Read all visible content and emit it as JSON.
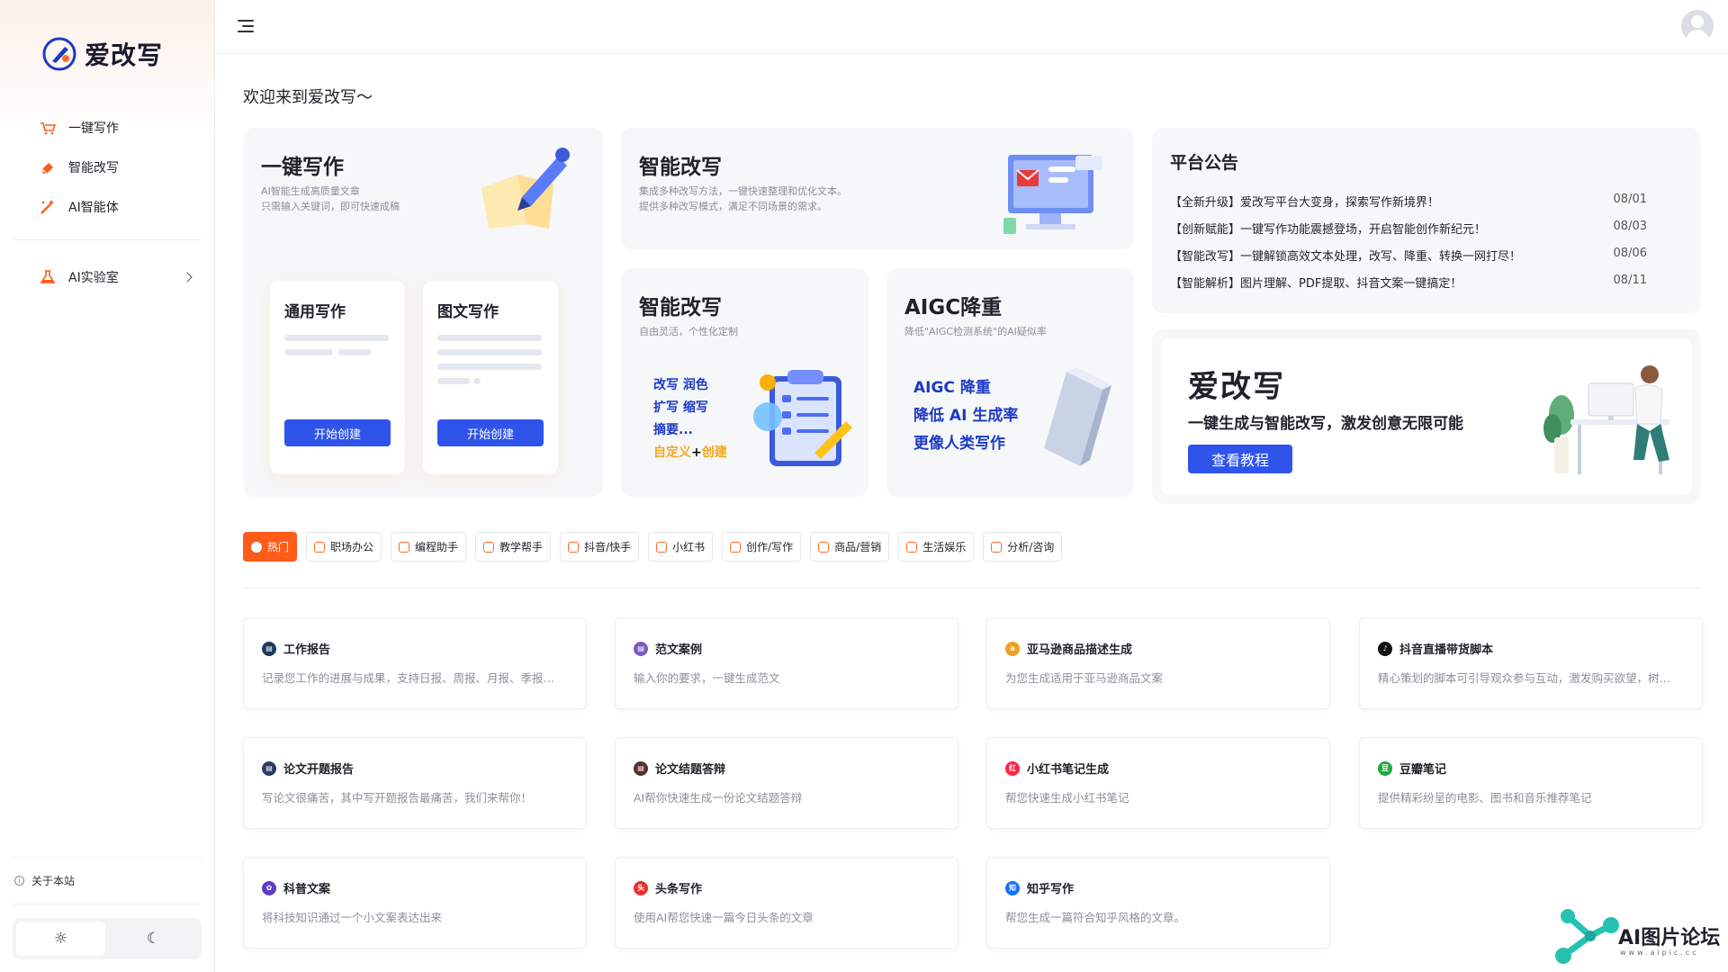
{
  "app": {
    "name": "爱改写"
  },
  "sidebar": {
    "items": [
      {
        "label": "一键写作",
        "icon": "cart-pen-icon"
      },
      {
        "label": "智能改写",
        "icon": "eraser-icon"
      },
      {
        "label": "AI智能体",
        "icon": "magic-wand-icon"
      }
    ],
    "lab": {
      "label": "AI实验室",
      "icon": "flask-icon"
    },
    "about": "关于本站",
    "theme": {
      "light": "☼",
      "dark": "☾"
    }
  },
  "main": {
    "welcome": "欢迎来到爱改写～",
    "write_card": {
      "title": "一键写作",
      "desc1": "AI智能生成高质量文章",
      "desc2": "只需输入关键词，即可快速成稿",
      "general": {
        "title": "通用写作",
        "button": "开始创建"
      },
      "graphic": {
        "title": "图文写作",
        "button": "开始创建"
      }
    },
    "rewrite_card_top": {
      "title": "智能改写",
      "desc1": "集成多种改写方法，一键快速整理和优化文本。",
      "desc2": "提供多种改写模式，满足不同场景的需求。"
    },
    "rewrite_card": {
      "title": "智能改写",
      "desc": "自由灵活，个性化定制",
      "features": [
        "改写 润色",
        "扩写 缩写",
        "摘要..."
      ],
      "custom": "自定义",
      "plus": "+",
      "create": "创建"
    },
    "aigc_card": {
      "title": "AIGC降重",
      "desc": "降低\"AIGC检测系统\"的AI疑似率",
      "lines": [
        "AIGC 降重",
        "降低 AI 生成率",
        "更像人类写作"
      ]
    },
    "notice": {
      "title": "平台公告",
      "items": [
        {
          "text": "【全新升级】爱改写平台大变身，探索写作新境界！",
          "date": "08/01"
        },
        {
          "text": "【创新赋能】一键写作功能震撼登场，开启智能创作新纪元！",
          "date": "08/03"
        },
        {
          "text": "【智能改写】一键解锁高效文本处理，改写、降重、转换一网打尽！",
          "date": "08/06"
        },
        {
          "text": "【智能解析】图片理解、PDF提取、抖音文案一键搞定！",
          "date": "08/11"
        }
      ]
    },
    "promo": {
      "title": "爱改写",
      "subtitle": "一键生成与智能改写，激发创意无限可能",
      "button": "查看教程"
    },
    "categories": [
      {
        "label": "热门",
        "active": true
      },
      {
        "label": "职场办公"
      },
      {
        "label": "编程助手"
      },
      {
        "label": "教学帮手"
      },
      {
        "label": "抖音/快手"
      },
      {
        "label": "小红书"
      },
      {
        "label": "创作/写作"
      },
      {
        "label": "商品/营销"
      },
      {
        "label": "生活娱乐"
      },
      {
        "label": "分析/咨询"
      }
    ],
    "tools": [
      {
        "title": "工作报告",
        "desc": "记录您工作的进展与成果，支持日报、周报、月报、季报…",
        "color": "#1f3a5f",
        "glyph": "▤"
      },
      {
        "title": "范文案例",
        "desc": "输入你的要求，一键生成范文",
        "color": "#7b5cc4",
        "glyph": "▤"
      },
      {
        "title": "亚马逊商品描述生成",
        "desc": "为您生成适用于亚马逊商品文案",
        "color": "#f0a020",
        "glyph": "a"
      },
      {
        "title": "抖音直播带货脚本",
        "desc": "精心策划的脚本可引导观众参与互动，激发购买欲望，树…",
        "color": "#111111",
        "glyph": "♪"
      },
      {
        "title": "论文开题报告",
        "desc": "写论文很痛苦，其中写开题报告最痛苦，我们来帮你！",
        "color": "#2b3a67",
        "glyph": "▤"
      },
      {
        "title": "论文结题答辩",
        "desc": "AI帮你快速生成一份论文结题答辩",
        "color": "#5a2f2f",
        "glyph": "▤"
      },
      {
        "title": "小红书笔记生成",
        "desc": "帮您快速生成小红书笔记",
        "color": "#ff2442",
        "glyph": "红"
      },
      {
        "title": "豆瓣笔记",
        "desc": "提供精彩纷呈的电影、图书和音乐推荐笔记",
        "color": "#1faa3c",
        "glyph": "豆"
      },
      {
        "title": "科普文案",
        "desc": "将科技知识通过一个小文案表达出来",
        "color": "#5b3fc8",
        "glyph": "✿"
      },
      {
        "title": "头条写作",
        "desc": "使用AI帮您快速一篇今日头条的文章",
        "color": "#e8302c",
        "glyph": "头"
      },
      {
        "title": "知乎写作",
        "desc": "帮您生成一篇符合知乎风格的文章。",
        "color": "#1772f6",
        "glyph": "知"
      }
    ]
  },
  "watermark": {
    "text": "AI图片论坛",
    "url": "www.aipic.cc"
  },
  "colors": {
    "primary": "#2f54eb",
    "accent": "#ff5c1a"
  }
}
